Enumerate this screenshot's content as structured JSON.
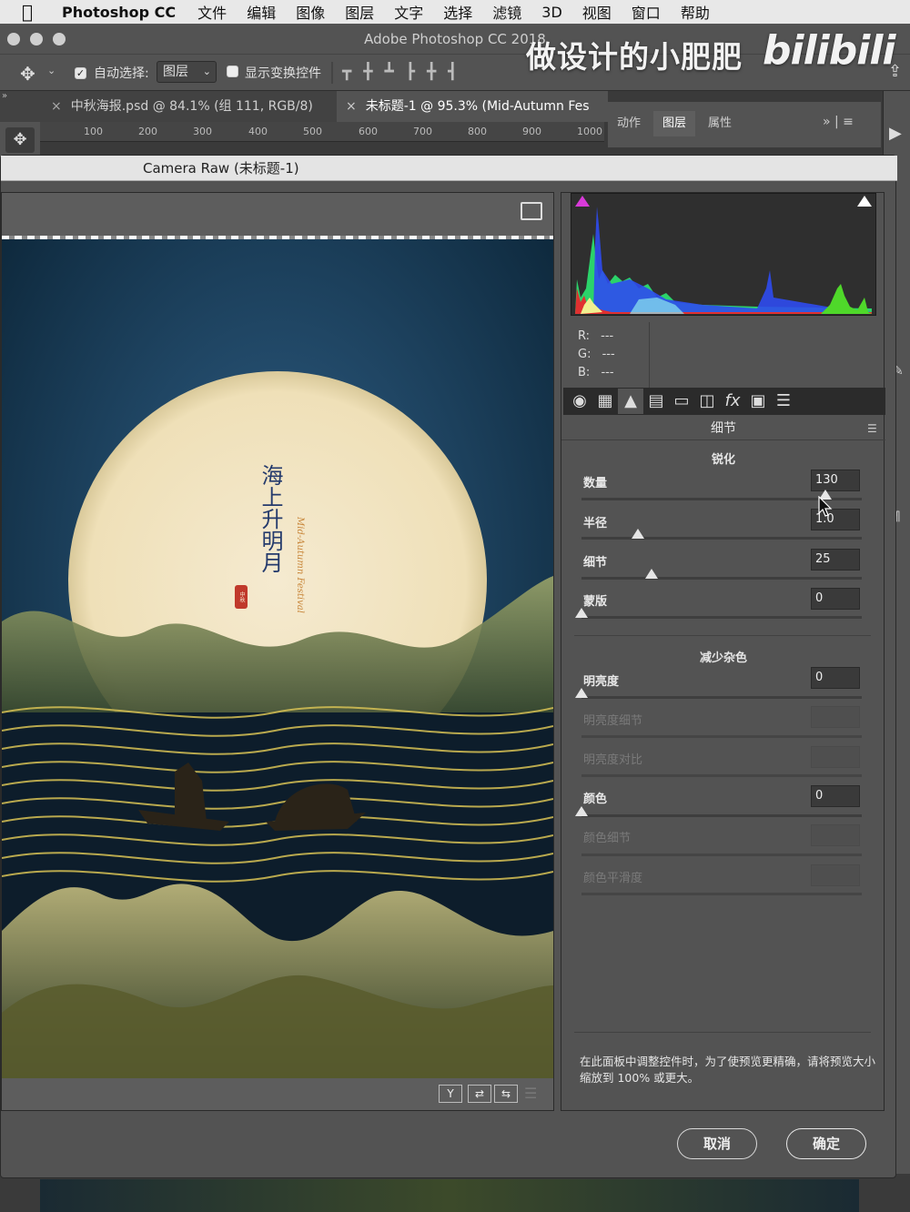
{
  "menubar": {
    "app": "Photoshop CC",
    "items": [
      "文件",
      "编辑",
      "图像",
      "图层",
      "文字",
      "选择",
      "滤镜",
      "3D",
      "视图",
      "窗口",
      "帮助"
    ]
  },
  "titlebar": {
    "title": "Adobe Photoshop CC 2018"
  },
  "watermark": {
    "text": "做设计的小肥肥",
    "brand": "bilibili"
  },
  "options": {
    "auto_select_label": "自动选择:",
    "auto_select_value": "图层",
    "show_transform_label": "显示变换控件"
  },
  "tabs": [
    {
      "label": "中秋海报.psd @ 84.1% (组 111, RGB/8)"
    },
    {
      "label": "未标题-1 @ 95.3% (Mid-Autumn Fes"
    }
  ],
  "ruler_ticks": [
    "100",
    "200",
    "300",
    "400",
    "500",
    "600",
    "700",
    "800",
    "900",
    "1000"
  ],
  "right_panel": {
    "tabs": [
      "动作",
      "图层",
      "属性"
    ]
  },
  "camera_raw": {
    "title": "Camera Raw (未标题-1)",
    "rgb": {
      "r_label": "R:",
      "g_label": "G:",
      "b_label": "B:",
      "r": "---",
      "g": "---",
      "b": "---"
    },
    "panel_title": "细节",
    "sharpen": {
      "heading": "锐化",
      "amount": {
        "label": "数量",
        "value": "130",
        "level": 0.87
      },
      "radius": {
        "label": "半径",
        "value": "1.0",
        "level": 0.2
      },
      "detail": {
        "label": "细节",
        "value": "25",
        "level": 0.25
      },
      "masking": {
        "label": "蒙版",
        "value": "0",
        "level": 0
      }
    },
    "noise": {
      "heading": "减少杂色",
      "luminance": {
        "label": "明亮度",
        "value": "0",
        "level": 0
      },
      "lum_detail": {
        "label": "明亮度细节"
      },
      "lum_contrast": {
        "label": "明亮度对比"
      },
      "color": {
        "label": "颜色",
        "value": "0",
        "level": 0
      },
      "color_detail": {
        "label": "颜色细节"
      },
      "color_smooth": {
        "label": "颜色平滑度"
      }
    },
    "note": "在此面板中调整控件时，为了使预览更精确，请将预览大小缩放到 100% 或更大。",
    "cancel": "取消",
    "ok": "确定",
    "bottom_buttons": [
      "Y",
      "⇄",
      "⇆"
    ]
  },
  "poster": {
    "title_vertical": "海上升明月",
    "subtitle_vertical": "Mid-Autumn Festival",
    "seal": "中秋"
  },
  "colors": {
    "accent": "#2d4f8c",
    "moon": "#f3e6c4",
    "gold": "#d8c255"
  }
}
